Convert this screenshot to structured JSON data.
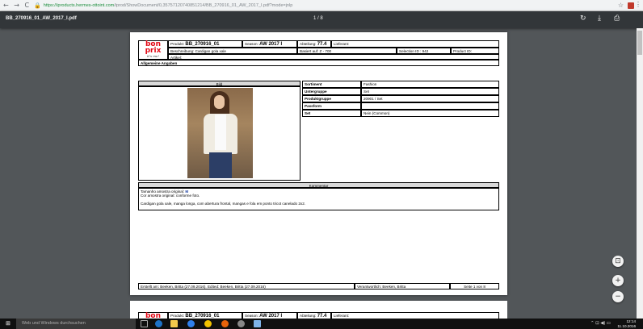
{
  "browser": {
    "nav": "← → C",
    "url_secure": "https://",
    "url_host": "iproducts.hermes-ottoint.com",
    "url_rest": "/iprod/ShowDocument/0,3575712074085121​4/BB_270916_01_AW_2017_I.pdf?mode=jnlp"
  },
  "pdf_toolbar": {
    "filename": "BB_270916_01_AW_2017_I.pdf",
    "page_indicator": "1 / 8"
  },
  "sheet": {
    "logo_text": "bon prix",
    "logo_tagline": "it's me!",
    "produkt_label": "Produkt:",
    "produkt_value": "BB_270916_01",
    "season_label": "Season:",
    "season_value": "AW 2017 I",
    "abteilung_label": "Abteilung:",
    "abteilung_value": "77.4",
    "lieferant_label": "Lieferant:",
    "beschreibung": "Beschreibung: Cardigan gola xale",
    "basiert": "Basiert auf: Z - 700",
    "selection": "Selection ID : 942",
    "product_id": "Product ID:",
    "artikel": "Artikel:",
    "allgemeine": "Allgemeine Angaben",
    "bild_header": "Bild",
    "attributes": [
      {
        "key": "Sortiment",
        "value": "Fashion"
      },
      {
        "key": "Untergruppe",
        "value": "Set"
      },
      {
        "key": "Produktgruppe",
        "value": "20901 / Set"
      },
      {
        "key": "Passform",
        "value": ""
      },
      {
        "key": "Set",
        "value": "Nein (Common)"
      }
    ],
    "kommentar_header": "Kommentar",
    "kommentar_line1_prefix": "Tamanho amostra original:",
    "kommentar_line1_value": "M",
    "kommentar_line2": "Cor amostra original: conforme foto.",
    "kommentar_line3": "Cardigan gola xale, manga longa, com abertura frontal, mangas e fola em ponto tricot canelado 2x2.",
    "footer_created": "Erstellt am: Beeken, Britta (27.09.2016). Edited: Beeken, Britta (27.09.2016)",
    "footer_responsible": "Verantwortlich: Beeken, Britta",
    "footer_page": "Seite 1 von 8"
  },
  "page2": {
    "produkt_label": "Produkt:",
    "produkt_value": "BB_270916_01",
    "season_label": "Season:",
    "season_value": "AW 2017 I",
    "abteilung_label": "Abteilung:",
    "abteilung_value": "77.4",
    "lieferant_label": "Lieferant:"
  },
  "taskbar": {
    "search_placeholder": "Web und Windows durchsuchen",
    "time": "12:14",
    "date": "11.10.2016"
  }
}
